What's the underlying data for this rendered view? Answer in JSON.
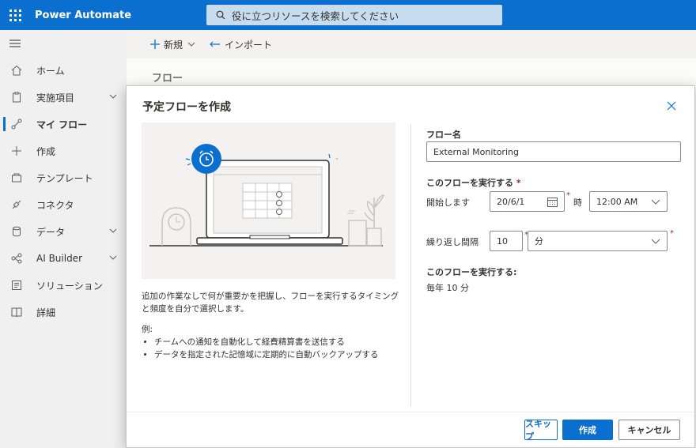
{
  "app": {
    "title": "Power Automate"
  },
  "search": {
    "placeholder": "役に立つリソースを検索してください"
  },
  "sidebar": {
    "items": [
      {
        "label": "ホーム",
        "icon": "home-icon"
      },
      {
        "label": "実施項目",
        "icon": "clipboard-icon",
        "expandable": true
      },
      {
        "label": "マイ フロー",
        "icon": "flow-icon",
        "active": true
      },
      {
        "label": "作成",
        "icon": "plus-icon"
      },
      {
        "label": "テンプレート",
        "icon": "template-icon"
      },
      {
        "label": "コネクタ",
        "icon": "connector-icon"
      },
      {
        "label": "データ",
        "icon": "database-icon",
        "expandable": true
      },
      {
        "label": "AI Builder",
        "icon": "ai-builder-icon",
        "expandable": true
      },
      {
        "label": "ソリューション",
        "icon": "solution-icon"
      },
      {
        "label": "詳細",
        "icon": "book-icon"
      }
    ]
  },
  "commandbar": {
    "new_label": "新規",
    "import_label": "インポート"
  },
  "content": {
    "title": "フロー"
  },
  "modal": {
    "title": "予定フローを作成",
    "description": "追加の作業なしで何が重要かを把握し、フローを実行するタイミングと頻度を自分で選択します。",
    "example_heading": "例:",
    "examples": [
      "チームへの通知を自動化して経費精算書を送信する",
      "データを指定された記憶域に定期的に自動バックアップする"
    ],
    "flow_name_label": "フロー名",
    "flow_name_value": "External Monitoring",
    "run_label": "このフローを実行する",
    "start_label": "開始します",
    "start_date": "20/6/1",
    "time_label": "時",
    "start_time": "12:00 AM",
    "repeat_label": "繰り返し間隔",
    "repeat_value": "10",
    "repeat_unit": "分",
    "summary_label": "このフローを実行する:",
    "summary_value": "毎年 10 分",
    "skip_label": "スキップ",
    "create_label": "作成",
    "cancel_label": "キャンセル"
  }
}
